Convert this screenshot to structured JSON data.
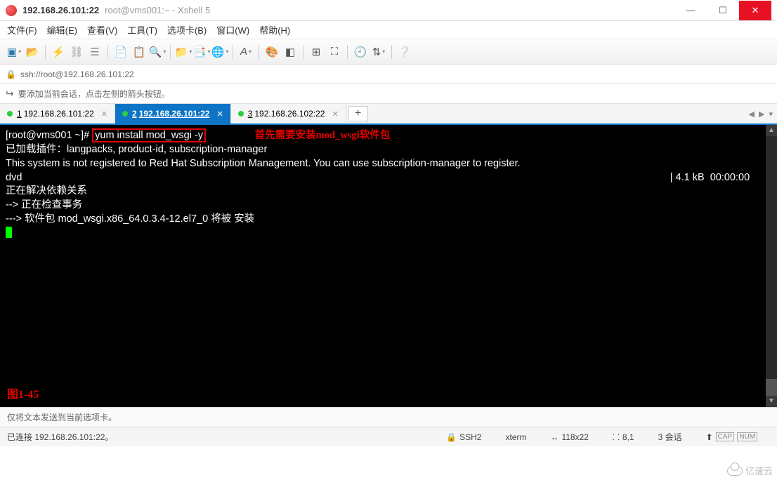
{
  "window": {
    "title_main": "192.168.26.101:22",
    "title_sub": "root@vms001:~ - Xshell 5"
  },
  "menu": {
    "file": "文件(F)",
    "edit": "编辑(E)",
    "view": "查看(V)",
    "tools": "工具(T)",
    "tabs": "选项卡(B)",
    "window": "窗口(W)",
    "help": "帮助(H)"
  },
  "address": {
    "url": "ssh://root@192.168.26.101:22"
  },
  "hint": {
    "text": "要添加当前会话，点击左侧的箭头按钮。"
  },
  "tabs": [
    {
      "num": "1",
      "label": "192.168.26.101:22",
      "active": false
    },
    {
      "num": "2",
      "label": "192.168.26.101:22",
      "active": true
    },
    {
      "num": "3",
      "label": "192.168.26.102:22",
      "active": false
    }
  ],
  "terminal": {
    "prompt": "[root@vms001 ~]# ",
    "cmd": "yum install mod_wsgi -y",
    "annotation": "首先需要安装mod_wsgi软件包",
    "line2": "已加载插件：langpacks, product-id, subscription-manager",
    "line3": "This system is not registered to Red Hat Subscription Management. You can use subscription-manager to register.",
    "line4a": "dvd",
    "line4b": "| 4.1 kB  00:00:00",
    "line5": "正在解决依赖关系",
    "line6": "--> 正在检查事务",
    "line7": "---> 软件包 mod_wsgi.x86_64.0.3.4-12.el7_0 将被 安装",
    "fig_label": "图1-45"
  },
  "footer": {
    "hint": "仅将文本发送到当前选项卡。",
    "status": "已连接 192.168.26.101:22。",
    "proto": "SSH2",
    "term": "xterm",
    "size": "118x22",
    "pos": "8,1",
    "sessions": "3 会话"
  },
  "watermark": "亿速云"
}
